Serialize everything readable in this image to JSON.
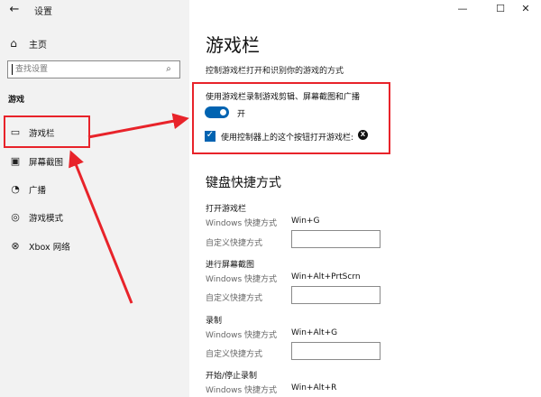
{
  "window": {
    "title": "设置",
    "minimize_glyph": "—",
    "maximize_glyph": "☐",
    "close_glyph": "✕"
  },
  "sidebar": {
    "home_label": "主页",
    "search_placeholder": "查找设置",
    "section_label": "游戏",
    "items": [
      {
        "label": "游戏栏",
        "icon": "game-bar-icon"
      },
      {
        "label": "屏幕截图",
        "icon": "captures-icon"
      },
      {
        "label": "广播",
        "icon": "broadcasting-icon"
      },
      {
        "label": "游戏模式",
        "icon": "game-mode-icon"
      },
      {
        "label": "Xbox 网络",
        "icon": "xbox-icon"
      }
    ]
  },
  "main": {
    "title": "游戏栏",
    "subtitle": "控制游戏栏打开和识别你的游戏的方式",
    "record_option_label": "使用游戏栏录制游戏剪辑、屏幕截图和广播",
    "toggle_state": "开",
    "controller_option_label": "使用控制器上的这个按钮打开游戏栏:",
    "keyboard_section_title": "键盘快捷方式",
    "shortcut_groups": [
      {
        "title": "打开游戏栏",
        "windows_label": "Windows 快捷方式",
        "windows_value": "Win+G",
        "custom_label": "自定义快捷方式"
      },
      {
        "title": "进行屏幕截图",
        "windows_label": "Windows 快捷方式",
        "windows_value": "Win+Alt+PrtScrn",
        "custom_label": "自定义快捷方式"
      },
      {
        "title": "录制",
        "windows_label": "Windows 快捷方式",
        "windows_value": "Win+Alt+G",
        "custom_label": "自定义快捷方式"
      },
      {
        "title": "开始/停止录制",
        "windows_label": "Windows 快捷方式",
        "windows_value": "Win+Alt+R"
      }
    ]
  },
  "colors": {
    "accent": "#0063b1",
    "annotation_red": "#e8232a",
    "sidebar_bg": "#f2f2f2"
  }
}
